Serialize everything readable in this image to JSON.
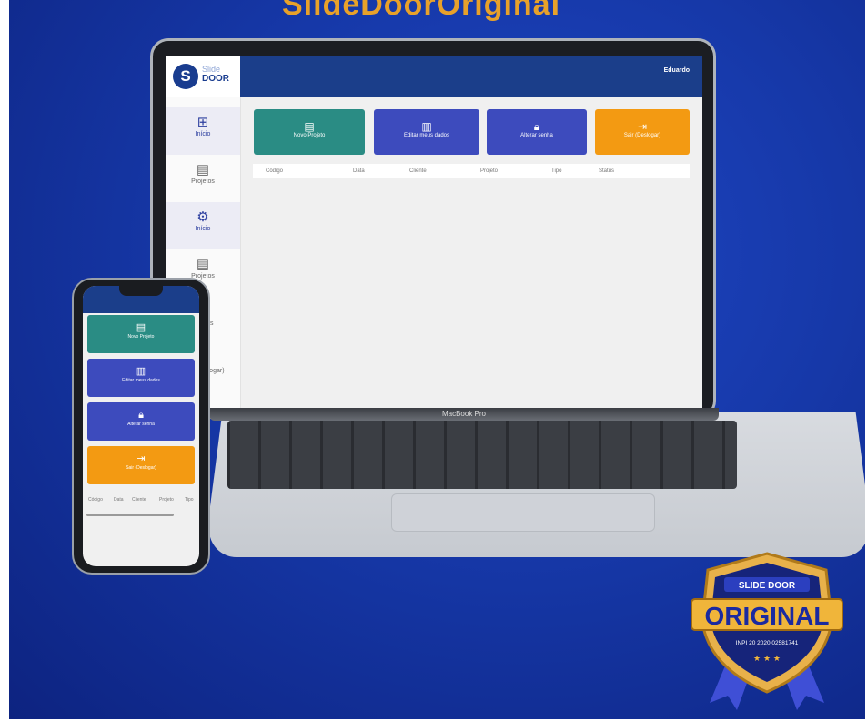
{
  "headline": "SlideDoorOriginal",
  "laptop": {
    "brand_top": "Slide",
    "brand_bottom": "DOOR",
    "user_name": "Eduardo",
    "model_label": "MacBook Pro",
    "nav": [
      {
        "label": "Início",
        "icon": "grid-icon"
      },
      {
        "label": "Projetos",
        "icon": "clipboard-icon"
      },
      {
        "label": "Início",
        "icon": "gear-icon"
      },
      {
        "label": "Projetos",
        "icon": "clipboard-icon"
      },
      {
        "label": "Ajustes",
        "icon": "gear-icon"
      },
      {
        "label": "Sair (Deslogar)",
        "icon": "logout-icon"
      }
    ],
    "cards": [
      {
        "label": "Novo Projeto",
        "color": "#2a8c84"
      },
      {
        "label": "Editar meus dados",
        "color": "#3d4bbd"
      },
      {
        "label": "Alterar senha",
        "color": "#3d4bbd"
      },
      {
        "label": "Sair (Deslogar)",
        "color": "#f39a12"
      }
    ],
    "table_headers": [
      "Código",
      "Data",
      "Cliente",
      "Projeto",
      "Tipo",
      "Status"
    ]
  },
  "phone": {
    "cards": [
      {
        "label": "Novo Projeto",
        "color": "#2a8c84"
      },
      {
        "label": "Editar meus dados",
        "color": "#3d4bbd"
      },
      {
        "label": "Alterar senha",
        "color": "#3d4bbd"
      },
      {
        "label": "Sair (Deslogar)",
        "color": "#f39a12"
      }
    ],
    "table_headers": [
      "Código",
      "Data",
      "Cliente",
      "Projeto",
      "Tipo"
    ]
  },
  "badge": {
    "top": "SLIDE DOOR",
    "main": "ORIGINAL",
    "registry": "INPI 20 2020 02581741",
    "stars": "★ ★ ★"
  }
}
